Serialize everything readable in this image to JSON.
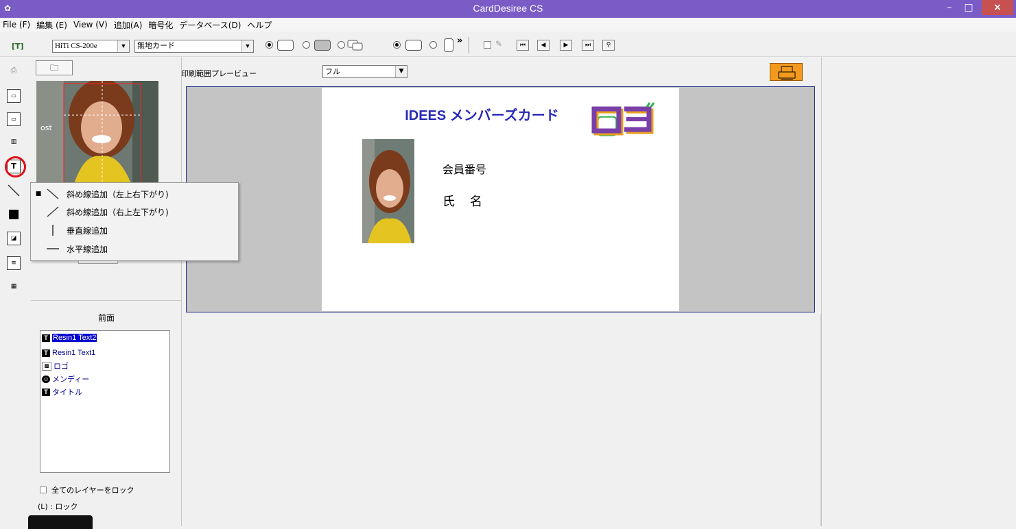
{
  "window": {
    "title": "CardDesiree CS",
    "minimize": "–",
    "maximize": "□",
    "close": "×"
  },
  "menu": [
    "File (F)",
    "編集 (E)",
    "View (V)",
    "追加(A)",
    "暗号化",
    "データベース(D)",
    "ヘルプ"
  ],
  "toolbar": {
    "printer": "HiTi CS-200e",
    "card_type": "無地カード",
    "more": "»"
  },
  "preview": {
    "label": "印刷範囲プレービュー",
    "mode": "フル"
  },
  "card": {
    "title": "IDEES  メンバーズカード",
    "logo_text": "ロゴ",
    "member_no_label": "会員番号",
    "name_label": "氏　名"
  },
  "photo_thumb_text": "ost",
  "context_menu": {
    "items": [
      {
        "label": "斜め線追加（左上右下がり)",
        "checked": true,
        "icon": "diagonal-down-line-icon"
      },
      {
        "label": "斜め線追加（右上左下がり)",
        "checked": false,
        "icon": "diagonal-up-line-icon"
      },
      {
        "label": "垂直線追加",
        "checked": false,
        "icon": "vertical-line-icon"
      },
      {
        "label": "水平線追加",
        "checked": false,
        "icon": "horizontal-line-icon"
      }
    ]
  },
  "layers": {
    "header": "前面",
    "items": [
      {
        "label": "Resin1 Text2",
        "selected": true,
        "icon": "text-layer-icon"
      },
      {
        "label": "Resin1 Text1",
        "selected": false,
        "icon": "text-layer-icon"
      },
      {
        "label": "ロゴ",
        "selected": false,
        "icon": "image-layer-icon"
      },
      {
        "label": "メンディー",
        "selected": false,
        "icon": "face-layer-icon"
      },
      {
        "label": "タイトル",
        "selected": false,
        "icon": "text-layer-icon"
      }
    ],
    "lock_all": "全てのレイヤーをロック",
    "lock_legend": "(L) : ロック"
  },
  "colors": {
    "titlebar": "#7b5cc7",
    "card_title": "#2a2ab8",
    "frame_border": "#1e2a88",
    "highlight": "#e0101a",
    "selection": "#0000d0"
  }
}
